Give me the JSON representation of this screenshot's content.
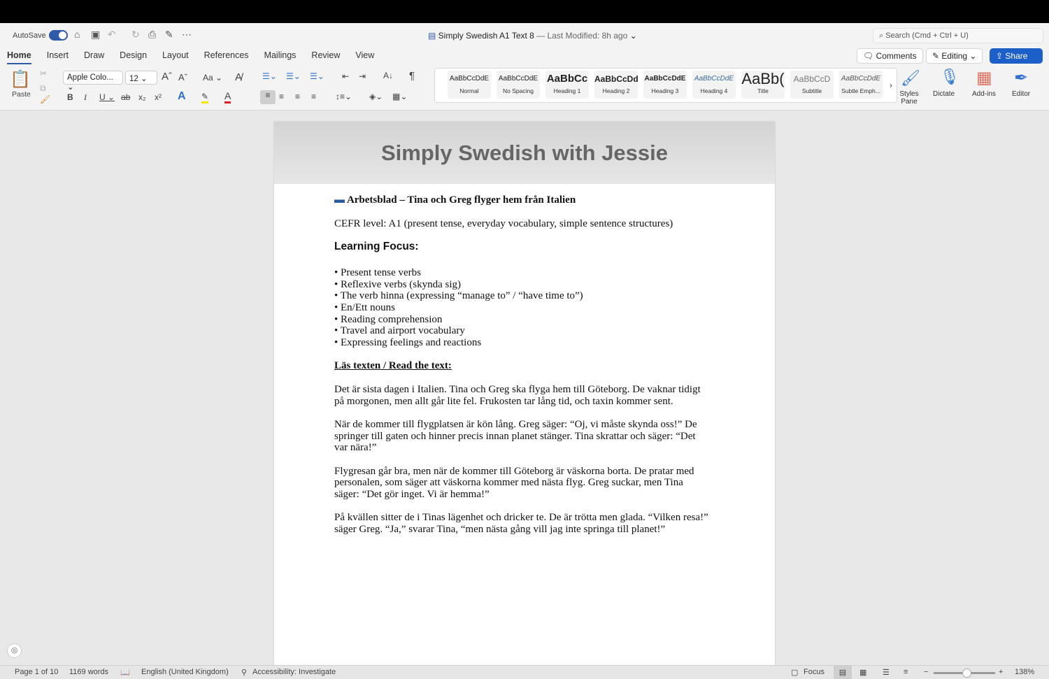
{
  "app": {
    "autosave": "AutoSave",
    "doc_title": "Simply Swedish A1 Text 8",
    "modified": "— Last Modified: 8h ago",
    "search_placeholder": "Search (Cmd + Ctrl + U)"
  },
  "tabs": [
    "Home",
    "Insert",
    "Draw",
    "Design",
    "Layout",
    "References",
    "Mailings",
    "Review",
    "View"
  ],
  "actions": {
    "comments": "Comments",
    "editing": "Editing",
    "share": "Share"
  },
  "ribbon": {
    "paste": "Paste",
    "font": "Apple Colo...",
    "size": "12",
    "styles_pane": "Styles Pane",
    "dictate": "Dictate",
    "addins": "Add-ins",
    "editor": "Editor"
  },
  "styles": [
    {
      "preview": "AaBbCcDdE",
      "name": "Normal"
    },
    {
      "preview": "AaBbCcDdE",
      "name": "No Spacing"
    },
    {
      "preview": "AaBbCc",
      "name": "Heading 1"
    },
    {
      "preview": "AaBbCcDd",
      "name": "Heading 2"
    },
    {
      "preview": "AaBbCcDdE",
      "name": "Heading 3"
    },
    {
      "preview": "AaBbCcDdE",
      "name": "Heading 4"
    },
    {
      "preview": "AaBb(",
      "name": "Title"
    },
    {
      "preview": "AaBbCcD",
      "name": "Subtitle"
    },
    {
      "preview": "AaBbCcDdE",
      "name": "Subtle Emph..."
    }
  ],
  "doc": {
    "header": "Simply Swedish with Jessie",
    "title": "Arbetsblad – Tina och Greg flyger hem från Italien",
    "cefr": "CEFR level: A1 (present tense, everyday vocabulary, simple sentence structures)",
    "focus_heading": "Learning Focus:",
    "bullets": [
      "• Present tense verbs",
      "• Reflexive verbs (skynda sig)",
      "• The verb hinna (expressing “manage to” / “have time to”)",
      "• En/Ett nouns",
      "• Reading comprehension",
      "• Travel and airport vocabulary",
      "• Expressing feelings and reactions"
    ],
    "read_heading": "Läs texten / Read the text:",
    "paragraphs": [
      "Det är sista dagen i Italien. Tina och Greg ska flyga hem till Göteborg. De vaknar tidigt på morgonen, men allt går lite fel. Frukosten tar lång tid, och taxin kommer sent.",
      "När de kommer till flygplatsen är kön lång. Greg säger: “Oj, vi måste skynda oss!” De springer till gaten och hinner precis innan planet stänger. Tina skrattar och säger: “Det var nära!”",
      "Flygresan går bra, men när de kommer till Göteborg är väskorna borta. De pratar med personalen, som säger att väskorna kommer med nästa flyg. Greg suckar, men Tina säger: “Det gör inget. Vi är hemma!”",
      "På kvällen sitter de i Tinas lägenhet och dricker te. De är trötta men glada. “Vilken resa!” säger Greg. “Ja,” svarar Tina, “men nästa gång vill jag inte springa till planet!”"
    ]
  },
  "status": {
    "page": "Page 1 of 10",
    "words": "1169 words",
    "language": "English (United Kingdom)",
    "accessibility": "Accessibility: Investigate",
    "focus": "Focus",
    "zoom": "138%"
  }
}
